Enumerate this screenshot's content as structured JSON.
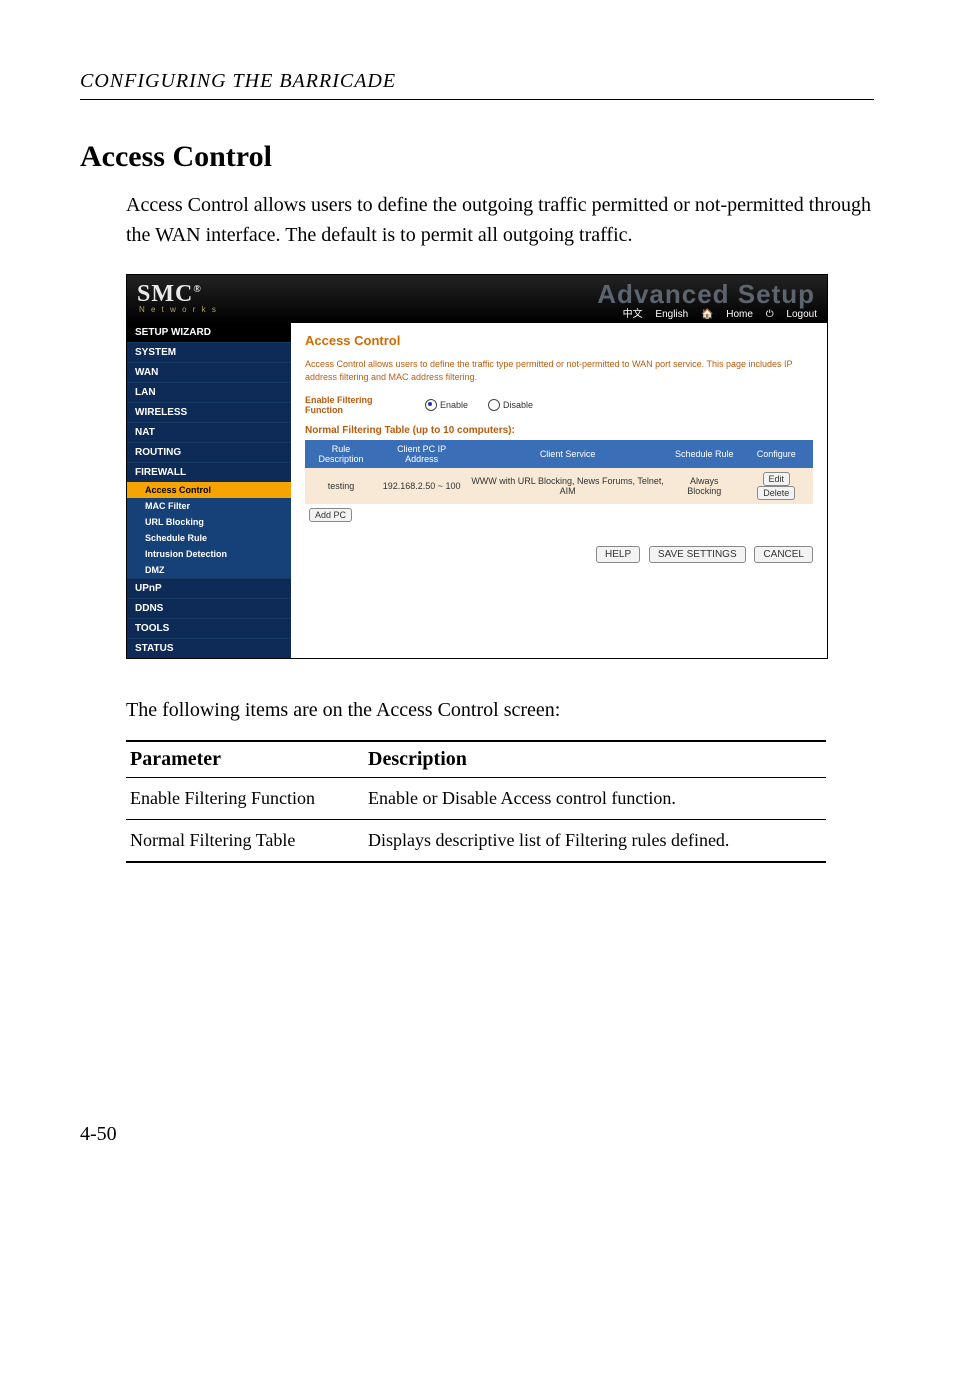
{
  "running_head": "CONFIGURING THE BARRICADE",
  "section_title": "Access Control",
  "body_para": "Access Control allows users to define the outgoing traffic permitted or not-permitted through the WAN interface. The default is to permit all outgoing traffic.",
  "screenshot": {
    "brand": "SMC",
    "brand_sup": "®",
    "sub_brand": "N e t w o r k s",
    "adv": "Advanced Setup",
    "lang": {
      "zh": "中文",
      "en": "English",
      "home": "Home",
      "logout": "Logout"
    },
    "sidebar": {
      "setup_wizard": "SETUP WIZARD",
      "system": "SYSTEM",
      "wan": "WAN",
      "lan": "LAN",
      "wireless": "WIRELESS",
      "nat": "NAT",
      "routing": "ROUTING",
      "firewall": "FIREWALL",
      "access_control": "Access Control",
      "mac_filter": "MAC Filter",
      "url_blocking": "URL Blocking",
      "schedule_rule": "Schedule Rule",
      "intrusion_detection": "Intrusion Detection",
      "dmz": "DMZ",
      "upnp": "UPnP",
      "ddns": "DDNS",
      "tools": "TOOLS",
      "status": "STATUS"
    },
    "content": {
      "title": "Access Control",
      "desc": "Access Control allows users to define the traffic type permitted or not-permitted to WAN port service. This page includes IP address filtering and MAC address filtering.",
      "enable_label": "Enable Filtering Function",
      "enable_opt": "Enable",
      "disable_opt": "Disable",
      "subtitle": "Normal Filtering Table (up to 10 computers):",
      "th_rule": "Rule Description",
      "th_ip": "Client PC IP Address",
      "th_service": "Client Service",
      "th_schedule": "Schedule Rule",
      "th_configure": "Configure",
      "row_rule": "testing",
      "row_ip": "192.168.2.50 ~ 100",
      "row_service": "WWW with URL Blocking, News Forums, Telnet, AIM",
      "row_schedule": "Always Blocking",
      "edit": "Edit",
      "delete": "Delete",
      "add_pc": "Add PC",
      "help": "HELP",
      "save": "SAVE SETTINGS",
      "cancel": "CANCEL"
    }
  },
  "below_para": "The following items are on the Access Control screen:",
  "param_table": {
    "h1": "Parameter",
    "h2": "Description",
    "r1c1": "Enable Filtering Function",
    "r1c2": "Enable or Disable Access control function.",
    "r2c1": "Normal Filtering Table",
    "r2c2": "Displays descriptive list of Filtering rules defined."
  },
  "page_num": "4-50"
}
